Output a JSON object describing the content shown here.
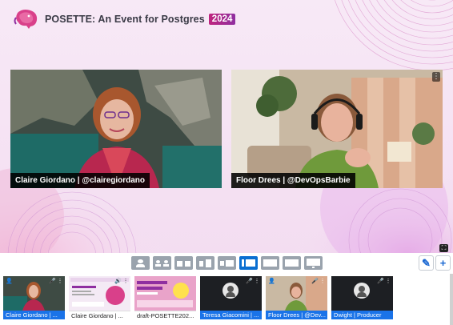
{
  "brand": {
    "title": "POSETTE: An Event for Postgres",
    "year": "2024",
    "logo_icon": "elephant-logo-icon",
    "colors": {
      "pink": "#d9408a",
      "purple": "#8f2fa0",
      "text": "#3a3a46"
    }
  },
  "stage": {
    "speakers": [
      {
        "name": "Claire Giordano | @clairegiordano",
        "more_icon": "more-vert-icon"
      },
      {
        "name": "Floor Drees | @DevOpsBarbie",
        "more_icon": "more-vert-icon"
      }
    ],
    "fullscreen_icon": "expand-icon"
  },
  "toolbar": {
    "layouts": [
      "solo-layout-icon",
      "cropped-layout-icon",
      "group-layout-icon",
      "leader-layout-icon",
      "screen-layout-icon",
      "picture-in-picture-icon",
      "cinema-layout-icon",
      "blank-layout-icon",
      "monitor-layout-icon"
    ],
    "active_layout": "picture-in-picture-icon",
    "edit_label": "✎",
    "add_label": "+",
    "accent": "#0a6ed1"
  },
  "backstage": [
    {
      "caption": "Claire Giordano | ...",
      "kind": "person"
    },
    {
      "caption": "Claire Giordano | ...",
      "kind": "screen"
    },
    {
      "caption": "draft-POSETTE202...",
      "kind": "screen"
    },
    {
      "caption": "Teresa Giacomini | ...",
      "kind": "person"
    },
    {
      "caption": "Floor Drees | @Dev...",
      "kind": "person"
    },
    {
      "caption": "Dwight | Producer",
      "kind": "person"
    }
  ]
}
